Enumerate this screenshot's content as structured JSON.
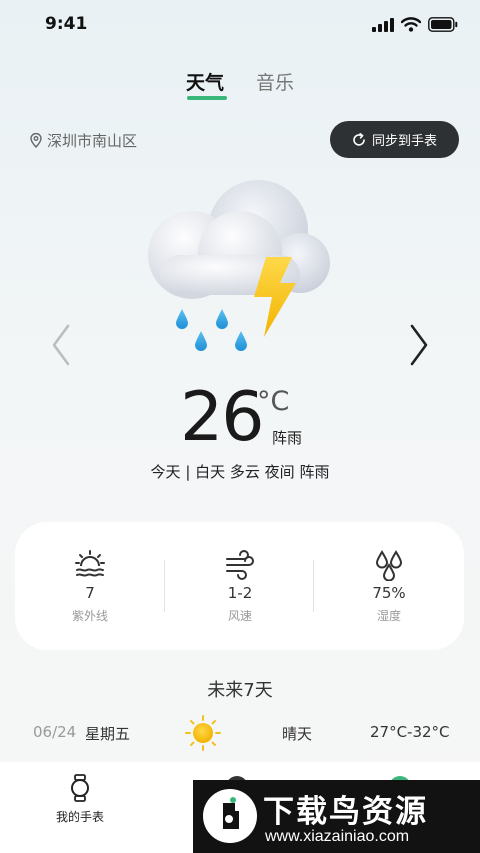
{
  "status_bar": {
    "time": "9:41"
  },
  "tabs": [
    {
      "label": "天气",
      "active": true
    },
    {
      "label": "音乐",
      "active": false
    }
  ],
  "location": {
    "name": "深圳市南山区"
  },
  "sync_button": {
    "label": "同步到手表"
  },
  "current": {
    "temperature": "26",
    "unit": "°C",
    "condition": "阵雨",
    "forecast_line": "今天 | 白天 多云  夜间 阵雨",
    "icon": "cloud-thunder-rain-icon"
  },
  "metrics": [
    {
      "icon": "uv-sunrise-icon",
      "value": "7",
      "label": "紫外线"
    },
    {
      "icon": "wind-icon",
      "value": "1-2",
      "label": "风速"
    },
    {
      "icon": "humidity-drops-icon",
      "value": "75%",
      "label": "湿度"
    }
  ],
  "future": {
    "title": "未来7天",
    "days": [
      {
        "date": "06/24",
        "weekday": "星期五",
        "condition": "晴天",
        "range": "27°C-32°C",
        "icon": "sun-icon"
      }
    ]
  },
  "bottom_nav": {
    "watch_label": "我的手表"
  },
  "watermark": {
    "title": "下载鸟资源",
    "url": "www.xiazainiao.com"
  },
  "colors": {
    "accent": "#39b67a",
    "dark_button": "#2e3133",
    "lightning": "#f5c518",
    "rain": "#2b9de0"
  }
}
